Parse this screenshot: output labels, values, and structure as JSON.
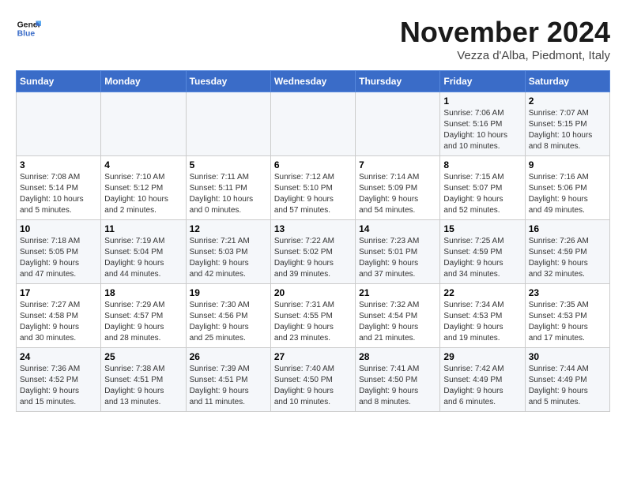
{
  "logo": {
    "line1": "General",
    "line2": "Blue"
  },
  "title": "November 2024",
  "subtitle": "Vezza d'Alba, Piedmont, Italy",
  "weekdays": [
    "Sunday",
    "Monday",
    "Tuesday",
    "Wednesday",
    "Thursday",
    "Friday",
    "Saturday"
  ],
  "weeks": [
    [
      {
        "day": "",
        "info": ""
      },
      {
        "day": "",
        "info": ""
      },
      {
        "day": "",
        "info": ""
      },
      {
        "day": "",
        "info": ""
      },
      {
        "day": "",
        "info": ""
      },
      {
        "day": "1",
        "info": "Sunrise: 7:06 AM\nSunset: 5:16 PM\nDaylight: 10 hours\nand 10 minutes."
      },
      {
        "day": "2",
        "info": "Sunrise: 7:07 AM\nSunset: 5:15 PM\nDaylight: 10 hours\nand 8 minutes."
      }
    ],
    [
      {
        "day": "3",
        "info": "Sunrise: 7:08 AM\nSunset: 5:14 PM\nDaylight: 10 hours\nand 5 minutes."
      },
      {
        "day": "4",
        "info": "Sunrise: 7:10 AM\nSunset: 5:12 PM\nDaylight: 10 hours\nand 2 minutes."
      },
      {
        "day": "5",
        "info": "Sunrise: 7:11 AM\nSunset: 5:11 PM\nDaylight: 10 hours\nand 0 minutes."
      },
      {
        "day": "6",
        "info": "Sunrise: 7:12 AM\nSunset: 5:10 PM\nDaylight: 9 hours\nand 57 minutes."
      },
      {
        "day": "7",
        "info": "Sunrise: 7:14 AM\nSunset: 5:09 PM\nDaylight: 9 hours\nand 54 minutes."
      },
      {
        "day": "8",
        "info": "Sunrise: 7:15 AM\nSunset: 5:07 PM\nDaylight: 9 hours\nand 52 minutes."
      },
      {
        "day": "9",
        "info": "Sunrise: 7:16 AM\nSunset: 5:06 PM\nDaylight: 9 hours\nand 49 minutes."
      }
    ],
    [
      {
        "day": "10",
        "info": "Sunrise: 7:18 AM\nSunset: 5:05 PM\nDaylight: 9 hours\nand 47 minutes."
      },
      {
        "day": "11",
        "info": "Sunrise: 7:19 AM\nSunset: 5:04 PM\nDaylight: 9 hours\nand 44 minutes."
      },
      {
        "day": "12",
        "info": "Sunrise: 7:21 AM\nSunset: 5:03 PM\nDaylight: 9 hours\nand 42 minutes."
      },
      {
        "day": "13",
        "info": "Sunrise: 7:22 AM\nSunset: 5:02 PM\nDaylight: 9 hours\nand 39 minutes."
      },
      {
        "day": "14",
        "info": "Sunrise: 7:23 AM\nSunset: 5:01 PM\nDaylight: 9 hours\nand 37 minutes."
      },
      {
        "day": "15",
        "info": "Sunrise: 7:25 AM\nSunset: 4:59 PM\nDaylight: 9 hours\nand 34 minutes."
      },
      {
        "day": "16",
        "info": "Sunrise: 7:26 AM\nSunset: 4:59 PM\nDaylight: 9 hours\nand 32 minutes."
      }
    ],
    [
      {
        "day": "17",
        "info": "Sunrise: 7:27 AM\nSunset: 4:58 PM\nDaylight: 9 hours\nand 30 minutes."
      },
      {
        "day": "18",
        "info": "Sunrise: 7:29 AM\nSunset: 4:57 PM\nDaylight: 9 hours\nand 28 minutes."
      },
      {
        "day": "19",
        "info": "Sunrise: 7:30 AM\nSunset: 4:56 PM\nDaylight: 9 hours\nand 25 minutes."
      },
      {
        "day": "20",
        "info": "Sunrise: 7:31 AM\nSunset: 4:55 PM\nDaylight: 9 hours\nand 23 minutes."
      },
      {
        "day": "21",
        "info": "Sunrise: 7:32 AM\nSunset: 4:54 PM\nDaylight: 9 hours\nand 21 minutes."
      },
      {
        "day": "22",
        "info": "Sunrise: 7:34 AM\nSunset: 4:53 PM\nDaylight: 9 hours\nand 19 minutes."
      },
      {
        "day": "23",
        "info": "Sunrise: 7:35 AM\nSunset: 4:53 PM\nDaylight: 9 hours\nand 17 minutes."
      }
    ],
    [
      {
        "day": "24",
        "info": "Sunrise: 7:36 AM\nSunset: 4:52 PM\nDaylight: 9 hours\nand 15 minutes."
      },
      {
        "day": "25",
        "info": "Sunrise: 7:38 AM\nSunset: 4:51 PM\nDaylight: 9 hours\nand 13 minutes."
      },
      {
        "day": "26",
        "info": "Sunrise: 7:39 AM\nSunset: 4:51 PM\nDaylight: 9 hours\nand 11 minutes."
      },
      {
        "day": "27",
        "info": "Sunrise: 7:40 AM\nSunset: 4:50 PM\nDaylight: 9 hours\nand 10 minutes."
      },
      {
        "day": "28",
        "info": "Sunrise: 7:41 AM\nSunset: 4:50 PM\nDaylight: 9 hours\nand 8 minutes."
      },
      {
        "day": "29",
        "info": "Sunrise: 7:42 AM\nSunset: 4:49 PM\nDaylight: 9 hours\nand 6 minutes."
      },
      {
        "day": "30",
        "info": "Sunrise: 7:44 AM\nSunset: 4:49 PM\nDaylight: 9 hours\nand 5 minutes."
      }
    ]
  ]
}
